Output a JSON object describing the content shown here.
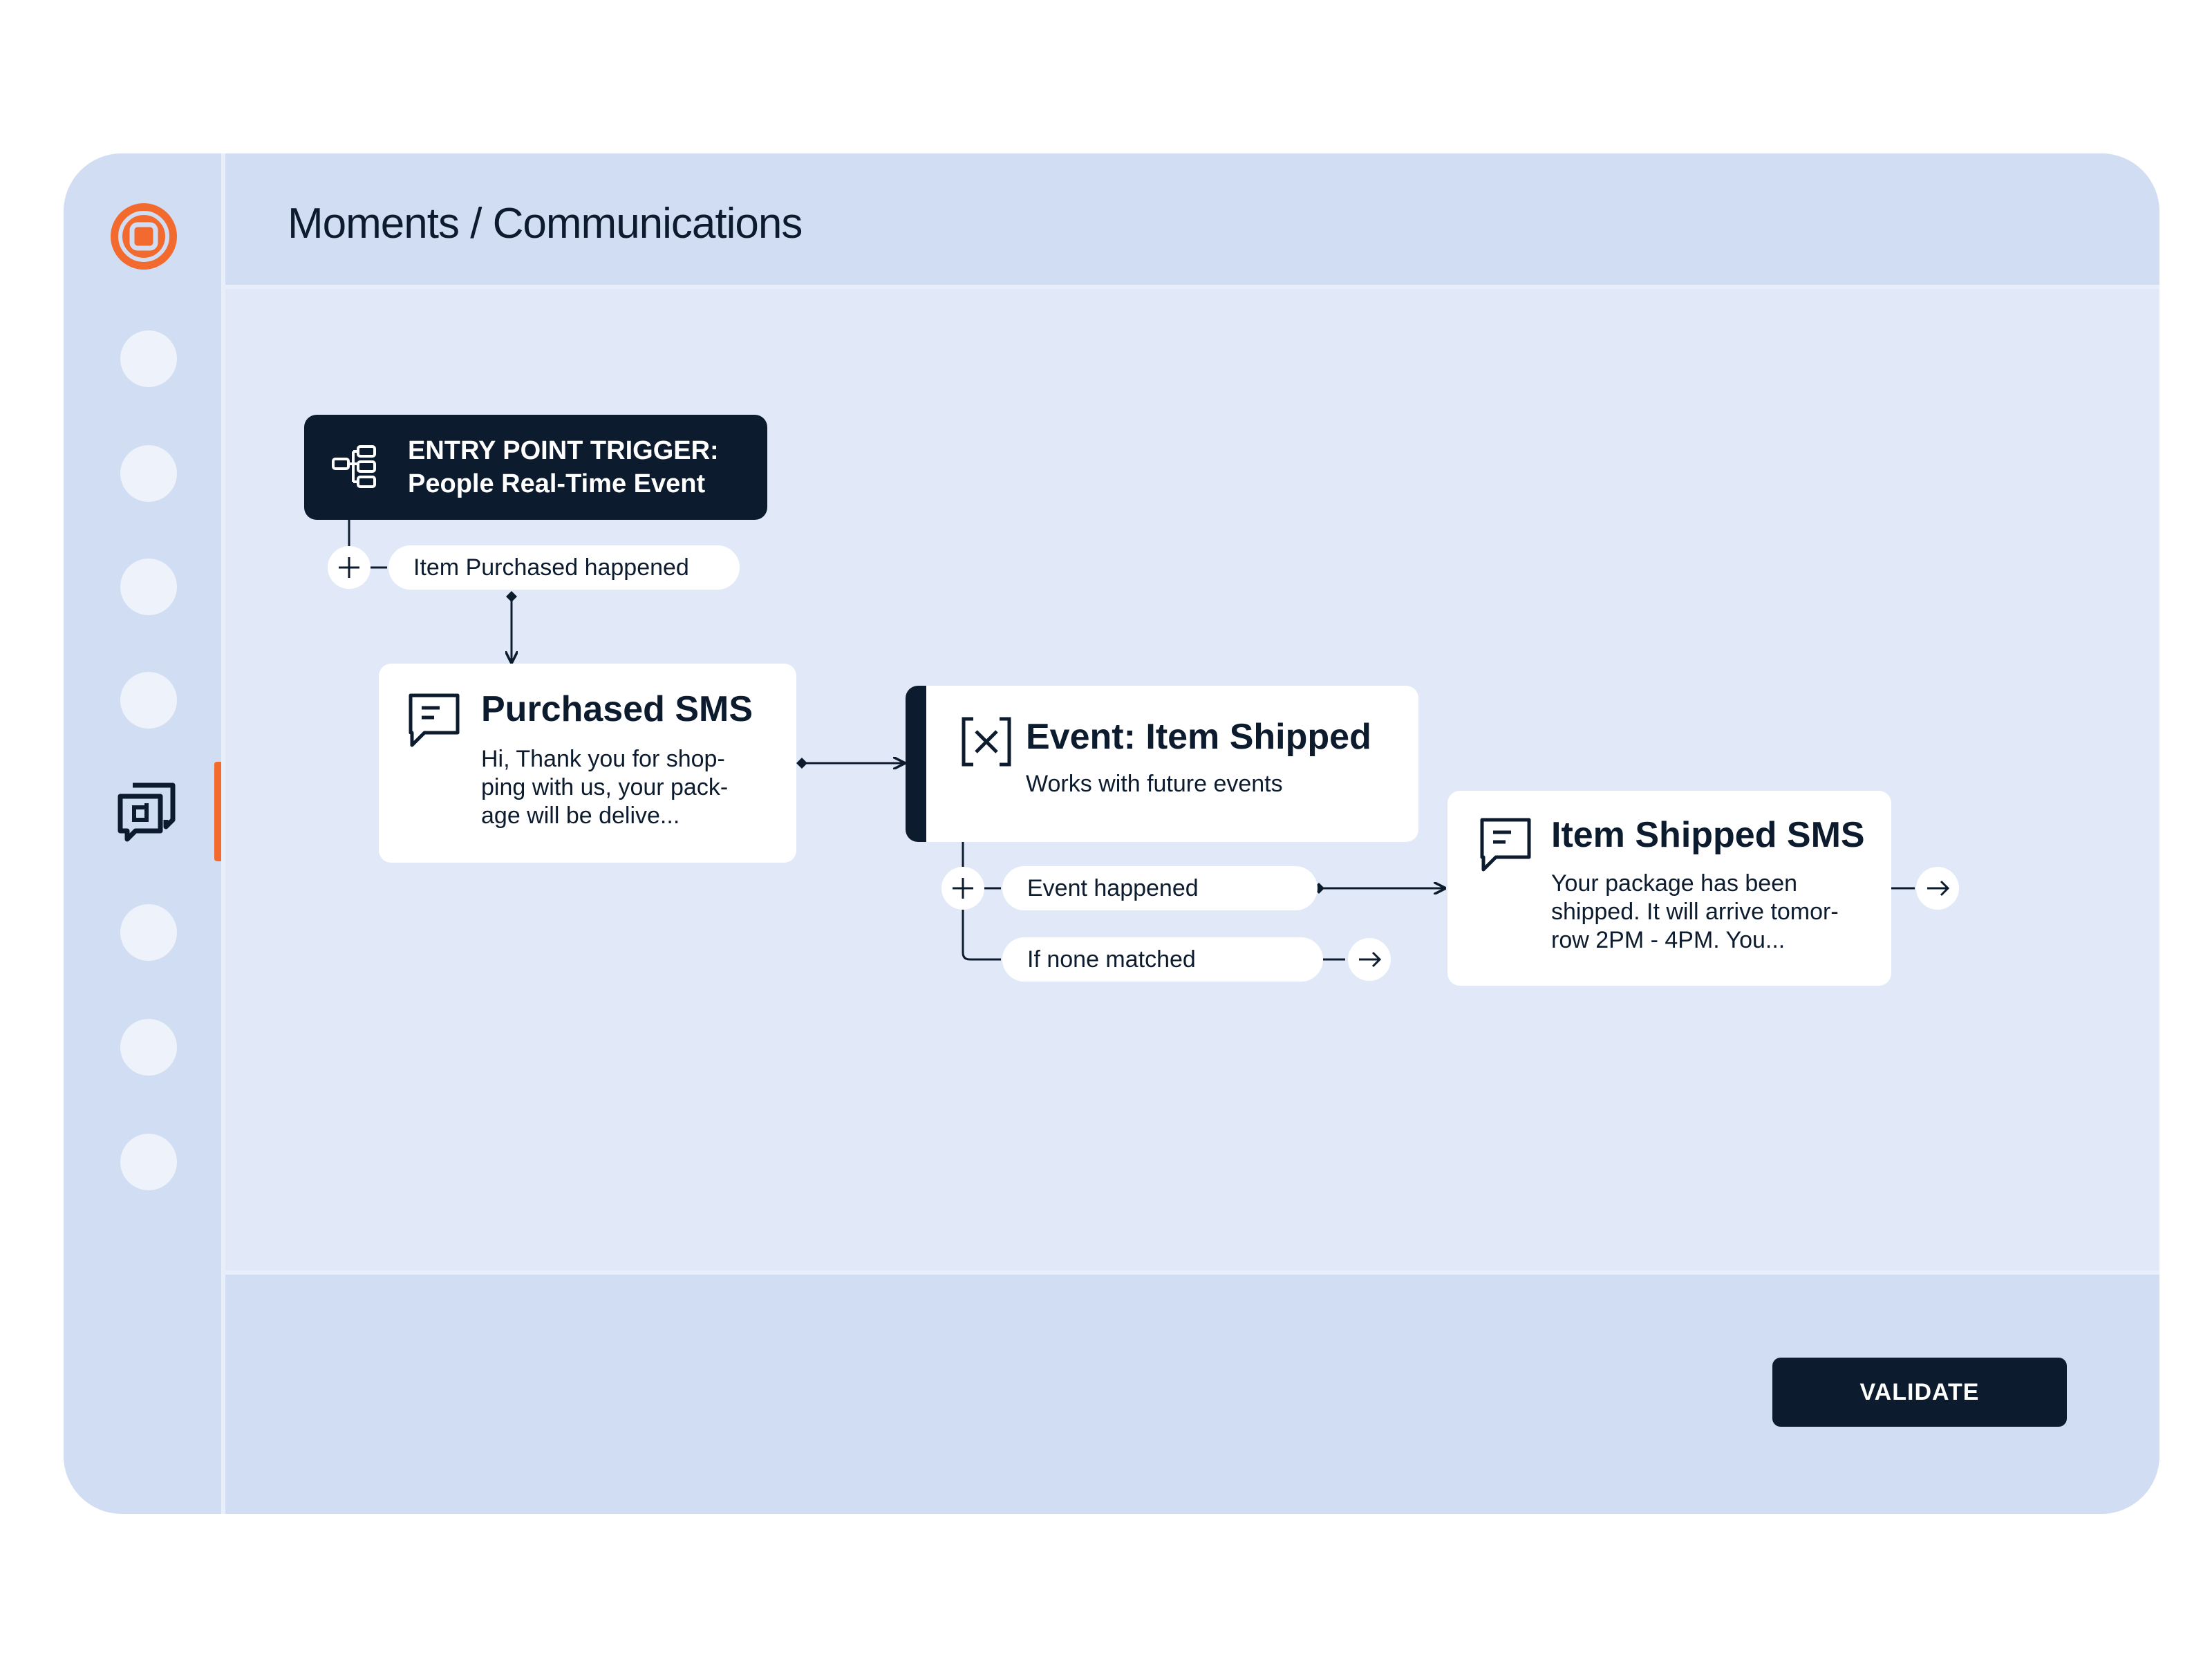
{
  "header": {
    "breadcrumb": "Moments / Communications"
  },
  "sidebar": {
    "logo": "target-logo",
    "items": [
      {
        "icon": "nav-dot"
      },
      {
        "icon": "nav-dot"
      },
      {
        "icon": "nav-dot"
      },
      {
        "icon": "nav-dot"
      },
      {
        "icon": "messages-icon",
        "active": true
      },
      {
        "icon": "nav-dot"
      },
      {
        "icon": "nav-dot"
      },
      {
        "icon": "nav-dot"
      }
    ],
    "accent_color": "#f26a2e"
  },
  "flow": {
    "trigger": {
      "line1": "ENTRY POINT TRIGGER:",
      "line2": "People Real-Time Event",
      "icon": "workflow-icon"
    },
    "trigger_condition": "Item Purchased happened",
    "purchased_sms": {
      "title": "Purchased SMS",
      "body_lines": [
        "Hi, Thank you for shop-",
        "ping with us, your pack-",
        "age will be delive..."
      ],
      "icon": "message-icon"
    },
    "event_node": {
      "title": "Event: Item Shipped",
      "subtitle": "Works with future events",
      "icon": "close-bracket-icon"
    },
    "branches": {
      "happened": "Event happened",
      "none": "If none matched"
    },
    "shipped_sms": {
      "title": "Item Shipped SMS",
      "body_lines": [
        "Your package has been",
        "shipped. It will arrive tomor-",
        "row 2PM - 4PM. You..."
      ],
      "icon": "message-icon"
    }
  },
  "footer": {
    "validate_label": "VALIDATE"
  },
  "colors": {
    "dark": "#0d1b2e",
    "panel": "#d1ddf2",
    "canvas": "#e1e8f7",
    "accent": "#f26a2e"
  }
}
